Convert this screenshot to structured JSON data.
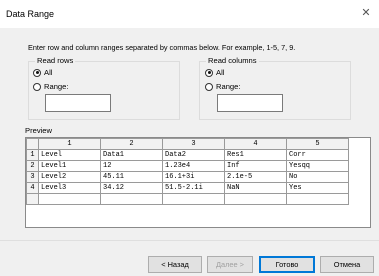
{
  "dialog": {
    "title": "Data Range",
    "close_icon": "close-icon"
  },
  "instructions": "Enter row and column ranges separated by commas below.  For example, 1-5, 7, 9.",
  "read_rows": {
    "label": "Read rows",
    "all_label": "All",
    "range_label": "Range:",
    "selected": "all",
    "range_value": ""
  },
  "read_columns": {
    "label": "Read columns",
    "all_label": "All",
    "range_label": "Range:",
    "selected": "all",
    "range_value": ""
  },
  "preview": {
    "label": "Preview",
    "columns": [
      "1",
      "2",
      "3",
      "4",
      "5"
    ],
    "rows": [
      {
        "num": "1",
        "cells": [
          "Level",
          "Data1",
          "Data2",
          "Res1",
          "Corr"
        ]
      },
      {
        "num": "2",
        "cells": [
          "Level1",
          "12",
          "1.23e4",
          "Inf",
          "Yesqq"
        ]
      },
      {
        "num": "3",
        "cells": [
          "Level2",
          "45.11",
          "16.1+3i",
          "2.1e-5",
          "No"
        ]
      },
      {
        "num": "4",
        "cells": [
          "Level3",
          "34.12",
          "51.5-2.1i",
          "NaN",
          "Yes"
        ]
      }
    ]
  },
  "buttons": {
    "back": "< Назад",
    "next": "Далее >",
    "finish": "Готово",
    "cancel": "Отмена"
  }
}
